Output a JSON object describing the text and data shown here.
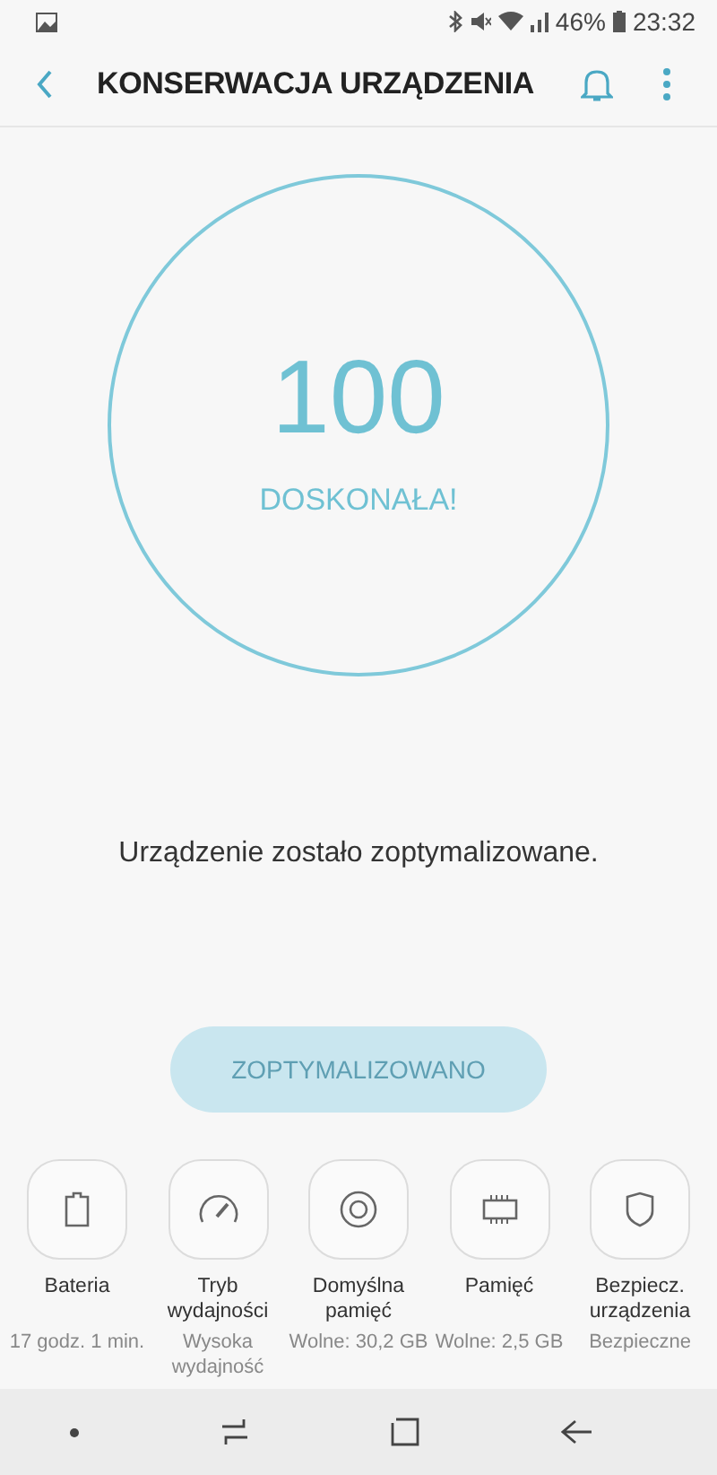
{
  "status_bar": {
    "battery": "46%",
    "time": "23:32"
  },
  "header": {
    "title": "KONSERWACJA URZĄDZENIA"
  },
  "score": {
    "value": "100",
    "label": "DOSKONAŁA!"
  },
  "message": "Urządzenie zostało zoptymalizowane.",
  "optimize_button": {
    "label": "ZOPTYMALIZOWANO",
    "disabled": true
  },
  "tiles": [
    {
      "kind": "battery",
      "label": "Bateria",
      "value": "17 godz. 1 min."
    },
    {
      "kind": "performance",
      "label": "Tryb wydajności",
      "value": "Wysoka wydajność"
    },
    {
      "kind": "storage",
      "label": "Domyślna pamięć",
      "value": "Wolne: 30,2 GB"
    },
    {
      "kind": "memory",
      "label": "Pamięć",
      "value": "Wolne: 2,5 GB"
    },
    {
      "kind": "security",
      "label": "Bezpiecz. urządzenia",
      "value": "Bezpieczne"
    }
  ]
}
